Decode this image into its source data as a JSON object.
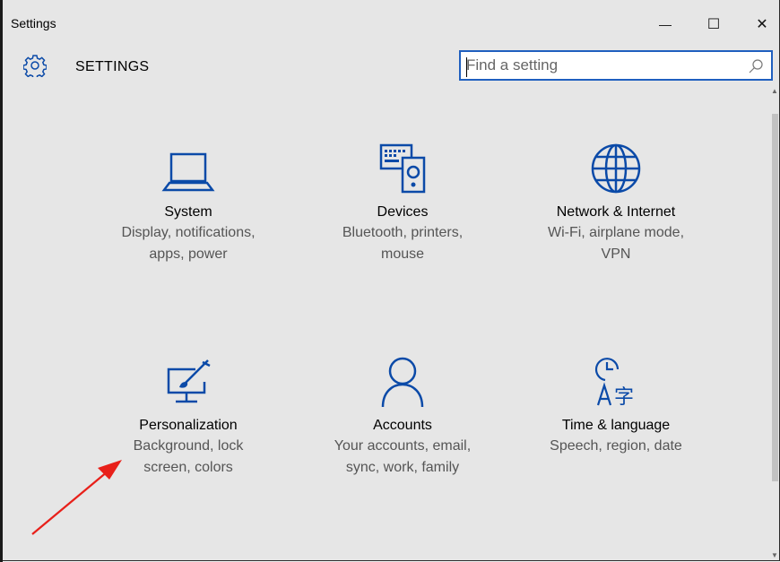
{
  "window": {
    "title": "Settings"
  },
  "window_controls": {
    "minimize": "—",
    "maximize": "☐",
    "close": "✕"
  },
  "header": {
    "title": "SETTINGS",
    "icon": "gear-icon"
  },
  "search": {
    "placeholder": "Find a setting",
    "value": ""
  },
  "tiles": [
    {
      "name": "System",
      "desc1": "Display, notifications,",
      "desc2": "apps, power",
      "icon": "laptop-icon"
    },
    {
      "name": "Devices",
      "desc1": "Bluetooth, printers,",
      "desc2": "mouse",
      "icon": "devices-icon"
    },
    {
      "name": "Network & Internet",
      "desc1": "Wi-Fi, airplane mode,",
      "desc2": "VPN",
      "icon": "globe-icon"
    },
    {
      "name": "Personalization",
      "desc1": "Background, lock",
      "desc2": "screen, colors",
      "icon": "personalization-icon"
    },
    {
      "name": "Accounts",
      "desc1": "Your accounts, email,",
      "desc2": "sync, work, family",
      "icon": "person-icon"
    },
    {
      "name": "Time & language",
      "desc1": "Speech, region, date",
      "desc2": "",
      "icon": "time-language-icon"
    }
  ],
  "colors": {
    "accent": "#0b4aa8",
    "annotation": "#e8201a",
    "background": "#e6e6e6"
  }
}
